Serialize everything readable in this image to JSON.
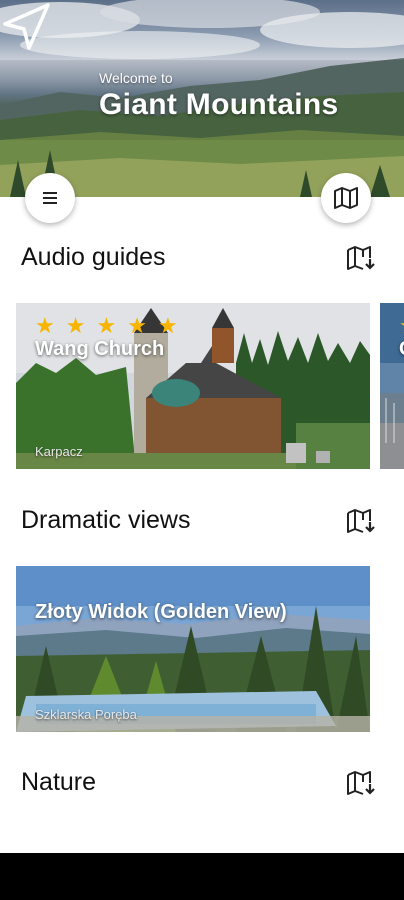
{
  "header": {
    "welcome": "Welcome to",
    "title": "Giant Mountains"
  },
  "sections": [
    {
      "title": "Audio guides",
      "cards": [
        {
          "title": "Wang Church",
          "location": "Karpacz",
          "rating": 5
        },
        {
          "title": "C",
          "location": "",
          "rating": 1
        }
      ]
    },
    {
      "title": "Dramatic views",
      "cards": [
        {
          "title": "Złoty Widok (Golden View)",
          "location": "Szklarska Poręba"
        }
      ]
    },
    {
      "title": "Nature",
      "cards": []
    }
  ],
  "icons": {
    "navigation": "navigation-arrow-icon",
    "menu": "menu-icon",
    "map": "map-icon",
    "star": "star-icon",
    "map_download": "map-download-icon"
  },
  "colors": {
    "star": "#f7b500",
    "text": "#111111",
    "navbar": "#000000"
  }
}
